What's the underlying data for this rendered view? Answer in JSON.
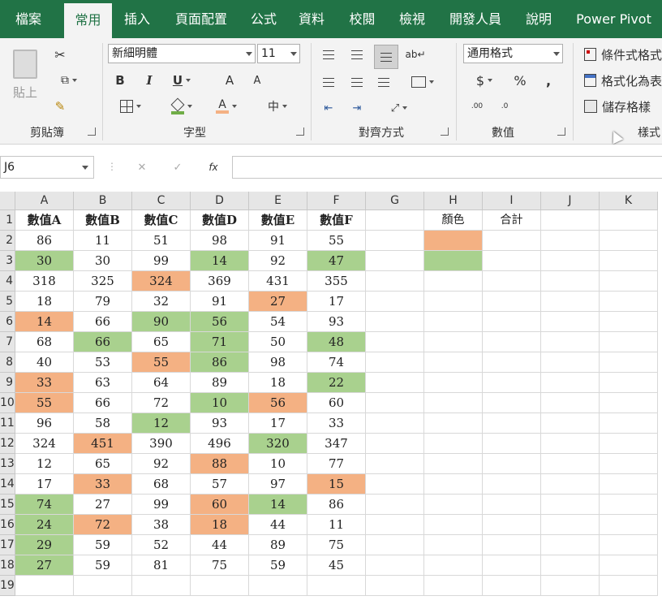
{
  "colors": {
    "orange": "#f4b183",
    "green": "#a9d18e",
    "brand": "#217346"
  },
  "tabs": [
    {
      "label": "檔案",
      "active": false
    },
    {
      "label": "常用",
      "active": true
    },
    {
      "label": "插入",
      "active": false
    },
    {
      "label": "頁面配置",
      "active": false
    },
    {
      "label": "公式",
      "active": false
    },
    {
      "label": "資料",
      "active": false
    },
    {
      "label": "校閱",
      "active": false
    },
    {
      "label": "檢視",
      "active": false
    },
    {
      "label": "開發人員",
      "active": false
    },
    {
      "label": "說明",
      "active": false
    },
    {
      "label": "Power Pivot",
      "active": false
    }
  ],
  "ribbon": {
    "clipboard": {
      "paste_label": "貼上",
      "group_label": "剪貼簿"
    },
    "font": {
      "font_name": "新細明體",
      "font_size": "11",
      "group_label": "字型",
      "bold": "B",
      "italic": "I",
      "underline": "U",
      "grow": "A",
      "shrink": "A",
      "font_color": "A",
      "phonetic": "中"
    },
    "alignment": {
      "group_label": "對齊方式"
    },
    "number": {
      "format": "通用格式",
      "currency": "$",
      "percent": "%",
      "comma": ",",
      "inc_decimal": ".00",
      "dec_decimal": ".0",
      "group_label": "數值"
    },
    "styles": {
      "conditional": "條件式格式",
      "as_table": "格式化為表",
      "cell_styles": "儲存格樣",
      "group_label": "樣式"
    }
  },
  "formula_bar": {
    "name_box": "J6",
    "cancel": "✕",
    "enter": "✓",
    "fx": "fx",
    "formula": ""
  },
  "sheet": {
    "columns": [
      "A",
      "B",
      "C",
      "D",
      "E",
      "F",
      "G",
      "H",
      "I",
      "J",
      "K"
    ],
    "row_numbers": [
      "1",
      "2",
      "3",
      "4",
      "5",
      "6",
      "7",
      "8",
      "9",
      "10",
      "11",
      "12",
      "13",
      "14",
      "15",
      "16",
      "17",
      "18",
      "19"
    ],
    "header_row": [
      "數值A",
      "數值B",
      "數值C",
      "數值D",
      "數值E",
      "數值F"
    ],
    "rows": [
      [
        "86",
        "11",
        "51",
        "98",
        "91",
        "55"
      ],
      [
        "30",
        "30",
        "99",
        "14",
        "92",
        "47"
      ],
      [
        "318",
        "325",
        "324",
        "369",
        "431",
        "355"
      ],
      [
        "18",
        "79",
        "32",
        "91",
        "27",
        "17"
      ],
      [
        "14",
        "66",
        "90",
        "56",
        "54",
        "93"
      ],
      [
        "68",
        "66",
        "65",
        "71",
        "50",
        "48"
      ],
      [
        "40",
        "53",
        "55",
        "86",
        "98",
        "74"
      ],
      [
        "33",
        "63",
        "64",
        "89",
        "18",
        "22"
      ],
      [
        "55",
        "66",
        "72",
        "10",
        "56",
        "60"
      ],
      [
        "96",
        "58",
        "12",
        "93",
        "17",
        "33"
      ],
      [
        "324",
        "451",
        "390",
        "496",
        "320",
        "347"
      ],
      [
        "12",
        "65",
        "92",
        "88",
        "10",
        "77"
      ],
      [
        "17",
        "33",
        "68",
        "57",
        "97",
        "15"
      ],
      [
        "74",
        "27",
        "99",
        "60",
        "14",
        "86"
      ],
      [
        "24",
        "72",
        "38",
        "18",
        "44",
        "11"
      ],
      [
        "29",
        "59",
        "52",
        "44",
        "89",
        "75"
      ],
      [
        "27",
        "59",
        "81",
        "75",
        "59",
        "45"
      ]
    ],
    "fills": [
      [
        "",
        "",
        "",
        "",
        "",
        ""
      ],
      [
        "g",
        "",
        "",
        "g",
        "",
        "g"
      ],
      [
        "",
        "",
        "o",
        "",
        "",
        ""
      ],
      [
        "",
        "",
        "",
        "",
        "o",
        ""
      ],
      [
        "o",
        "",
        "g",
        "g",
        "",
        ""
      ],
      [
        "",
        "g",
        "",
        "g",
        "",
        "g"
      ],
      [
        "",
        "",
        "o",
        "g",
        "",
        ""
      ],
      [
        "o",
        "",
        "",
        "",
        "",
        "g"
      ],
      [
        "o",
        "",
        "",
        "g",
        "o",
        ""
      ],
      [
        "",
        "",
        "g",
        "",
        "",
        ""
      ],
      [
        "",
        "o",
        "",
        "",
        "g",
        ""
      ],
      [
        "",
        "",
        "",
        "o",
        "",
        ""
      ],
      [
        "",
        "o",
        "",
        "",
        "",
        "o"
      ],
      [
        "g",
        "",
        "",
        "o",
        "g",
        ""
      ],
      [
        "g",
        "o",
        "",
        "o",
        "",
        ""
      ],
      [
        "g",
        "",
        "",
        "",
        "",
        ""
      ],
      [
        "g",
        "",
        "",
        "",
        "",
        ""
      ]
    ],
    "legend": {
      "color_header": "顏色",
      "total_header": "合計"
    }
  }
}
